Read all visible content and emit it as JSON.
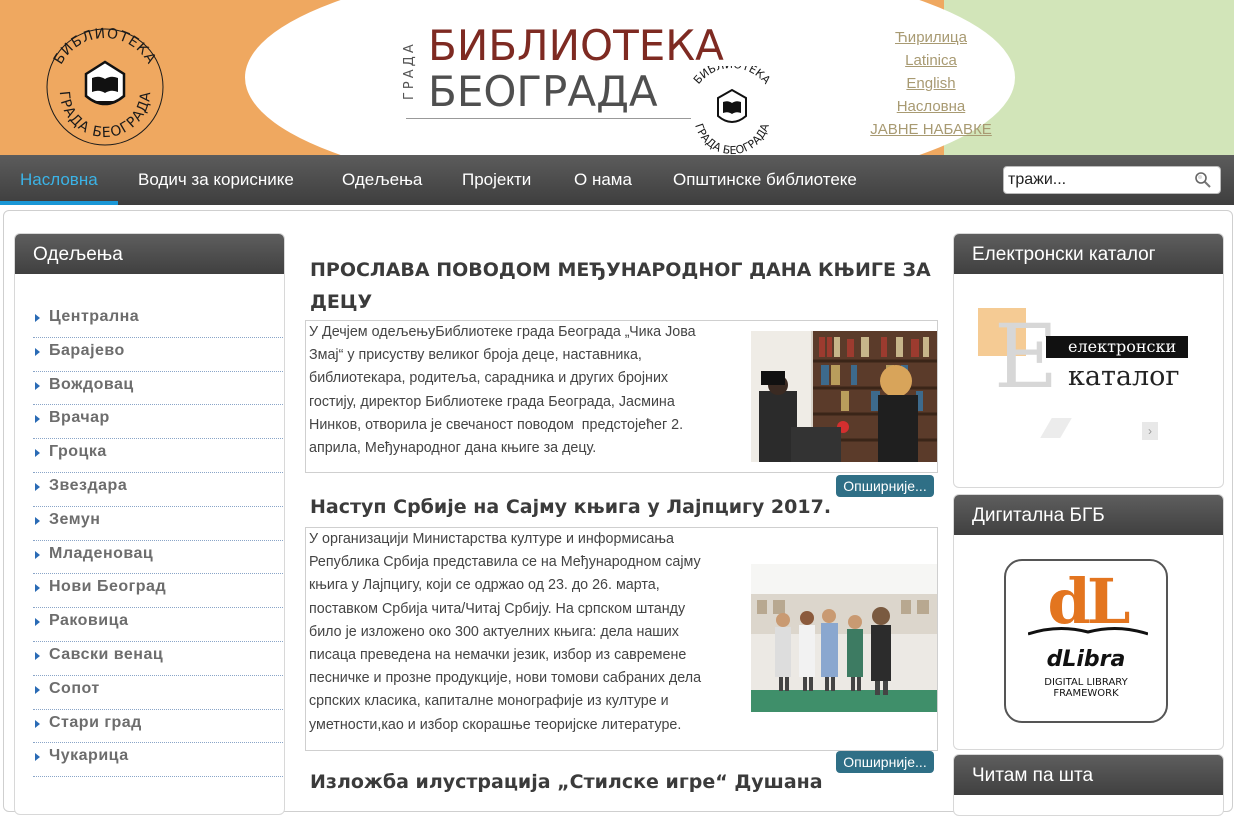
{
  "header": {
    "title_side": "ГРАДА",
    "title_line1": "БИБЛИОТЕКА",
    "title_line2": "БЕОГРАДА",
    "colors": {
      "orange": "#efa860",
      "green": "#d2e5b9",
      "burgundy": "#7e2a22"
    },
    "languages": [
      "Ћирилица",
      "Latinica",
      "English",
      "Насловна",
      "ЈАВНЕ НАБАВКЕ"
    ]
  },
  "nav": {
    "items": [
      "Насловна",
      "Водич за кориснике",
      "Одељења",
      "Пројекти",
      "О нама",
      "Општинске библиотеке"
    ],
    "active_index": 0,
    "search_placeholder": "тражи..."
  },
  "sidebar": {
    "title": "Одељења",
    "items": [
      "Централна",
      "Барајево",
      "Вождовац",
      "Врачар",
      "Гроцка",
      "Звездара",
      "Земун",
      "Младеновац",
      "Нови Београд",
      "Раковица",
      "Савски венац",
      "Сопот",
      "Стари град",
      "Чукарица"
    ]
  },
  "articles": [
    {
      "title_line1": "ПРОСЛАВА ПОВОДОМ МЕЂУНАРОДНОГ ДАНА КЊИГЕ ЗА",
      "title_line2": "ДЕЦУ",
      "lines": [
        "У Дечјем одељењуБиблиотеке града Београда „Чика Јова",
        "Змај“ у присуству великог броја деце, наставника,",
        "библиотекара, родитеља, сарадника и других бројних",
        "гостију, директор Библиотеке града Београда, Јасмина",
        "Нинков, отворила је свечаност поводом  предстојећег 2.",
        "априла, Међународног дана књиге за децу."
      ],
      "more": "Опширније..."
    },
    {
      "title_line1": "Наступ Србије на Сајму књига у Лајпцигу 2017.",
      "lines": [
        "У организацији Министарства културе и информисања",
        "Република Србија представила се на Међународном сајму",
        "књига у Лајпцигу, који се одржао од 23. до 26. марта,",
        "поставком Србија чита/Читај Србију. На српском штанду",
        "било је изложено око 300 актуелних књига: дела наших",
        "писаца преведена на немачки језик, избор из савремене",
        "песничке и прозне продукције, нови томови сабраних дела",
        "српских класика, капиталне монографије из културе и",
        "уметности,као и избор скорашње теоријске литературе."
      ],
      "more": "Опширније..."
    },
    {
      "title_line1": "Изложба илустрација „Стилске игре“ Душана"
    }
  ],
  "right": {
    "catalog_title": "Електронски каталог",
    "catalog_word1": "електронски",
    "catalog_word2": "каталог",
    "digital_title": "Дигитална БГБ",
    "dlibra_logo": "dL",
    "dlibra_name": "dLibra",
    "dlibra_sub1": "DIGITAL LIBRARY",
    "dlibra_sub2": "FRAMEWORK",
    "reading_title": "Читам па шта"
  }
}
